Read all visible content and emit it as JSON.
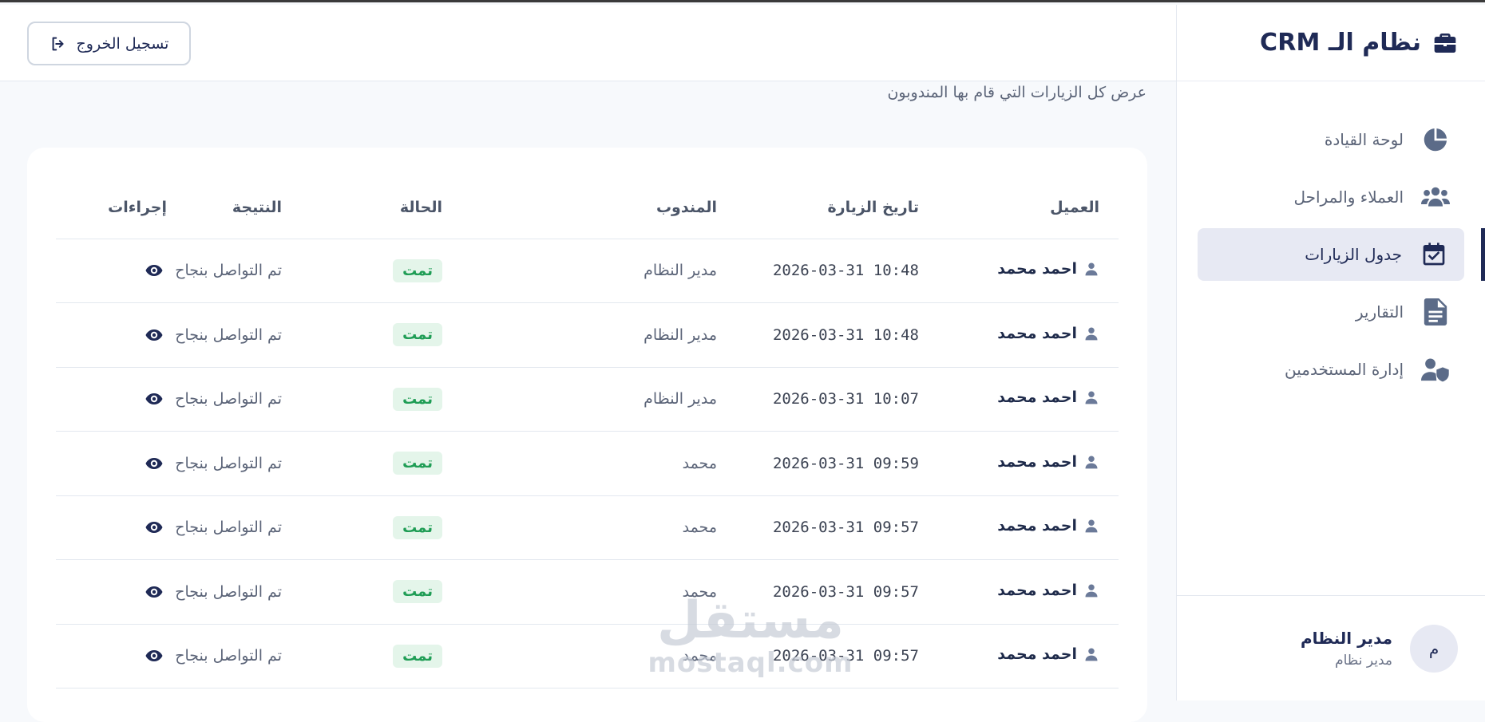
{
  "app": {
    "title": "نظام الـ CRM",
    "subtitle": "عرض كل الزيارات التي قام بها المندوبون",
    "logout_label": "تسجيل الخروج"
  },
  "sidebar": {
    "items": [
      {
        "label": "لوحة القيادة",
        "icon": "pie-chart-icon",
        "active": false
      },
      {
        "label": "العملاء والمراحل",
        "icon": "users-icon",
        "active": false
      },
      {
        "label": "جدول الزيارات",
        "icon": "calendar-check-icon",
        "active": true
      },
      {
        "label": "التقارير",
        "icon": "report-icon",
        "active": false
      },
      {
        "label": "إدارة المستخدمين",
        "icon": "user-shield-icon",
        "active": false
      }
    ],
    "user": {
      "initial": "م",
      "name": "مدير النظام",
      "role": "مدير نظام"
    }
  },
  "table": {
    "headers": {
      "client": "العميل",
      "date": "تاريخ الزيارة",
      "agent": "المندوب",
      "status": "الحالة",
      "result": "النتيجة",
      "actions": "إجراءات"
    },
    "rows": [
      {
        "client": "احمد محمد",
        "date": "2026-03-31  10:48",
        "agent": "مدير النظام",
        "status": "تمت",
        "result": "تم التواصل بنجاح"
      },
      {
        "client": "احمد محمد",
        "date": "2026-03-31  10:48",
        "agent": "مدير النظام",
        "status": "تمت",
        "result": "تم التواصل بنجاح"
      },
      {
        "client": "احمد محمد",
        "date": "2026-03-31  10:07",
        "agent": "مدير النظام",
        "status": "تمت",
        "result": "تم التواصل بنجاح"
      },
      {
        "client": "احمد محمد",
        "date": "2026-03-31  09:59",
        "agent": "محمد",
        "status": "تمت",
        "result": "تم التواصل بنجاح"
      },
      {
        "client": "احمد محمد",
        "date": "2026-03-31  09:57",
        "agent": "محمد",
        "status": "تمت",
        "result": "تم التواصل بنجاح"
      },
      {
        "client": "احمد محمد",
        "date": "2026-03-31  09:57",
        "agent": "محمد",
        "status": "تمت",
        "result": "تم التواصل بنجاح"
      },
      {
        "client": "احمد محمد",
        "date": "2026-03-31  09:57",
        "agent": "محمد",
        "status": "تمت",
        "result": "تم التواصل بنجاح"
      }
    ]
  },
  "watermark": {
    "arabic": "مستقل",
    "latin": "mostaql.com"
  },
  "colors": {
    "primary": "#1f2a56",
    "status_success_bg": "#e4f5ea",
    "status_success_text": "#1f9d55",
    "background": "#f7f9fc"
  }
}
